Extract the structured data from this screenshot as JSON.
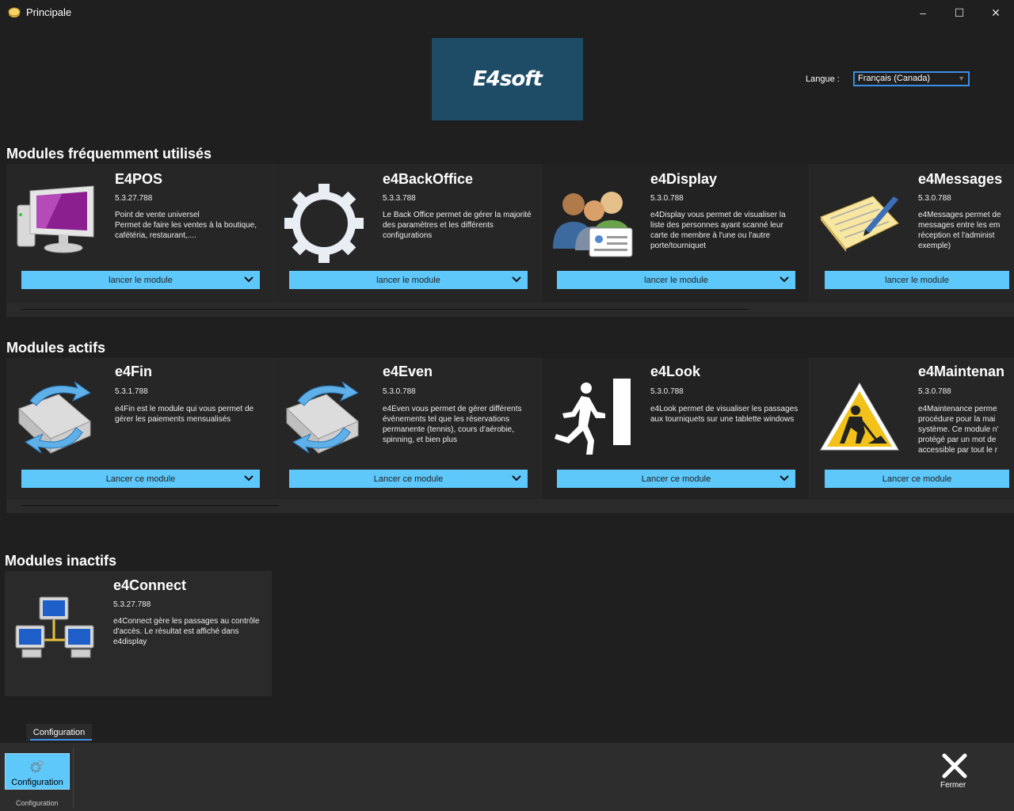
{
  "window": {
    "title": "Principale",
    "minimize": "–",
    "maximize": "☐",
    "close": "✕"
  },
  "logo": {
    "text": "E4soft"
  },
  "language": {
    "label": "Langue :",
    "value": "Français (Canada)"
  },
  "sections": {
    "frequent": {
      "title": "Modules fréquemment utilisés",
      "cards": [
        {
          "title": "E4POS",
          "version": "5.3.27.788",
          "description": "Point de vente universel\nPermet de faire les ventes à la boutique, cafétéria, restaurant,....",
          "button": "lancer le module",
          "icon": "monitor-icon"
        },
        {
          "title": "e4BackOffice",
          "version": "5.3.3.788",
          "description": "Le Back Office permet de gérer la majorité des paramètres et les différents configurations",
          "button": "lancer le module",
          "icon": "gear-icon"
        },
        {
          "title": "e4Display",
          "version": "5.3.0.788",
          "description": "e4Display vous permet de visualiser la liste des personnes ayant scanné leur carte de membre à l'une ou l'autre porte/tourniquet",
          "button": "lancer le module",
          "icon": "people-icon"
        },
        {
          "title": "e4Messages",
          "version": "5.3.0.788",
          "description": "e4Messages permet de messages entre les em réception et l'administ exemple)",
          "button": "lancer le module",
          "icon": "notepad-icon"
        }
      ]
    },
    "active": {
      "title": "Modules actifs",
      "cards": [
        {
          "title": "e4Fin",
          "version": "5.3.1.788",
          "description": "e4Fin est le module qui vous permet de gérer les paiements mensualisés",
          "button": "Lancer ce module",
          "icon": "mail-sync-icon"
        },
        {
          "title": "e4Even",
          "version": "5.3.0.788",
          "description": "e4Even vous permet de gérer différents événements tel que les réservations permanente (tennis), cours d'aérobie, spinning, et bien plus",
          "button": "Lancer ce module",
          "icon": "mail-sync-icon"
        },
        {
          "title": "e4Look",
          "version": "5.3.0.788",
          "description": "e4Look permet de visualiser les passages aux tourniquets sur une tablette windows",
          "button": "Lancer ce module",
          "icon": "exit-person-icon"
        },
        {
          "title": "e4Maintenan",
          "version": "5.3.0.788",
          "description": "e4Maintenance perme procédure pour la mai système. Ce module n' protégé par un mot de accessible par tout le r",
          "button": "Lancer ce module",
          "icon": "warning-worker-icon"
        }
      ]
    },
    "inactive": {
      "title": "Modules inactifs",
      "cards": [
        {
          "title": "e4Connect",
          "version": "5.3.27.788",
          "description": "e4Connect gère les passages au contrôle d'accès. Le résultat est affiché dans e4display",
          "icon": "network-icon"
        }
      ]
    }
  },
  "footer": {
    "tab": "Configuration",
    "config_button": "Configuration",
    "group_label": "Configuration",
    "close_label": "Fermer"
  },
  "colors": {
    "accent": "#5ec8fb",
    "background": "#1f1f1f",
    "logo_bg": "#1e4c66"
  }
}
